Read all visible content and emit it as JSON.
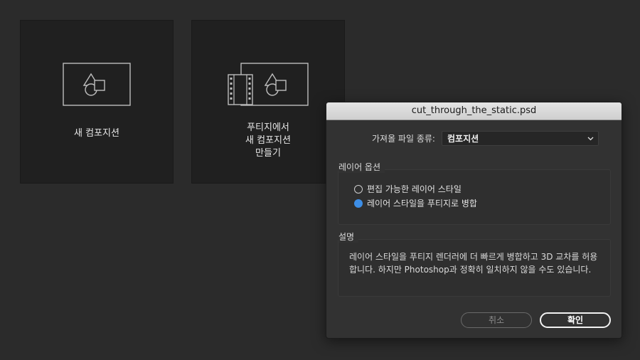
{
  "cards": [
    {
      "label_lines": [
        "새 컴포지션"
      ]
    },
    {
      "label_lines": [
        "푸티지에서",
        "새 컴포지션",
        "만들기"
      ]
    }
  ],
  "dialog": {
    "title": "cut_through_the_static.psd",
    "import_kind_label": "가져올 파일 종류:",
    "import_kind_value": "컴포지션",
    "layer_options": {
      "title": "레이어 옵션",
      "options": [
        {
          "label": "편집 가능한 레이어 스타일",
          "selected": false
        },
        {
          "label": "레이어 스타일을 푸티지로 병합",
          "selected": true
        }
      ]
    },
    "description": {
      "title": "설명",
      "text": "레이어 스타일을 푸티지 렌더러에 더 빠르게 병합하고 3D 교차를 허용합니다. 하지만 Photoshop과 정확히 일치하지 않을 수도 있습니다."
    },
    "buttons": {
      "cancel": "취소",
      "ok": "확인"
    }
  },
  "colors": {
    "accent": "#3d8ee6",
    "background": "#2b2b2b",
    "panel": "#323232"
  }
}
